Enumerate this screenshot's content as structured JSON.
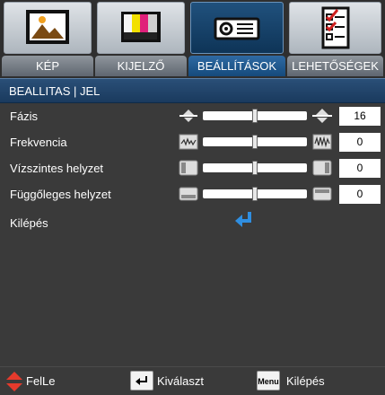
{
  "tabs": [
    {
      "label": "KÉP",
      "icon": "picture-icon",
      "active": false
    },
    {
      "label": "KIJELZŐ",
      "icon": "display-icon",
      "active": false
    },
    {
      "label": "BEÁLLÍTÁSOK",
      "icon": "projector-icon",
      "active": true
    },
    {
      "label": "LEHETŐSÉGEK",
      "icon": "options-checklist-icon",
      "active": false
    }
  ],
  "section": {
    "title": "BEALLITAS | JEL"
  },
  "settings": [
    {
      "label": "Fázis",
      "value": "16",
      "level": 0.5,
      "icon": "phase-icon"
    },
    {
      "label": "Frekvencia",
      "value": "0",
      "level": 0.5,
      "icon": "frequency-icon"
    },
    {
      "label": "Vízszintes helyzet",
      "value": "0",
      "level": 0.5,
      "icon": "horizontal-position-icon"
    },
    {
      "label": "Függőleges helyzet",
      "value": "0",
      "level": 0.5,
      "icon": "vertical-position-icon"
    }
  ],
  "exit": {
    "label": "Kilépés",
    "icon": "enter-arrow-icon"
  },
  "footer": {
    "navigate_label": "FelLe",
    "select_key": "enter-key-icon",
    "select_label": "Kiválaszt",
    "menu_key": "Menu",
    "exit_label": "Kilépés"
  },
  "colors": {
    "background": "#3a3a3a",
    "accent": "#1c4f82",
    "header": "#2a4f78",
    "arrow": "#e53a2c",
    "enter_arrow": "#2f8ee0"
  }
}
